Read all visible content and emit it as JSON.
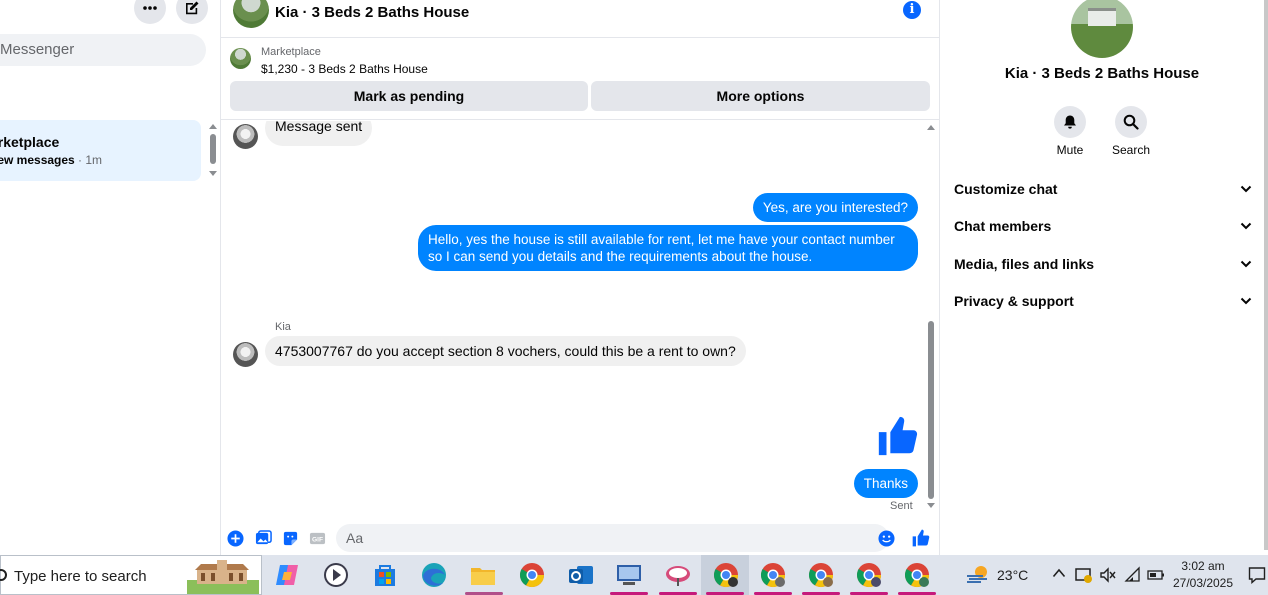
{
  "sidebar": {
    "search_placeholder": "Messenger",
    "conversation": {
      "name": "arketplace",
      "preview_bold": "new messages",
      "time": " · 1m"
    }
  },
  "chat": {
    "title": "Kia · 3 Beds 2 Baths House",
    "marketplace": {
      "label": "Marketplace",
      "listing": "$1,230 - 3 Beds 2 Baths House",
      "mark_pending": "Mark as pending",
      "more_options": "More options"
    },
    "messages": [
      {
        "from": "them",
        "text": "Message sent"
      },
      {
        "from": "me",
        "text": "Yes, are you interested?"
      },
      {
        "from": "me",
        "text": "Hello, yes the house is still available for rent, let me have your contact number so I can send you details and the requirements about the house."
      },
      {
        "from": "them",
        "sender": "Kia",
        "text": "4753007767 do you accept section 8 vochers, could this be a rent to own?"
      },
      {
        "from": "me",
        "type": "like-sticker"
      },
      {
        "from": "me",
        "text": "Thanks"
      }
    ],
    "status": "Sent",
    "composer_placeholder": "Aa",
    "colors": {
      "accent": "#0866ff",
      "bubble_out": "#0084ff",
      "bubble_in": "#f0f0f0"
    }
  },
  "right_panel": {
    "title": "Kia · 3 Beds 2 Baths House",
    "actions": [
      {
        "label": "Mute",
        "icon": "bell-icon"
      },
      {
        "label": "Search",
        "icon": "search-icon"
      }
    ],
    "sections": [
      "Customize chat",
      "Chat members",
      "Media, files and links",
      "Privacy & support"
    ]
  },
  "taskbar": {
    "search_text": "Type here to search",
    "weather": "23°C",
    "time": "3:02 am",
    "date": "27/03/2025"
  }
}
